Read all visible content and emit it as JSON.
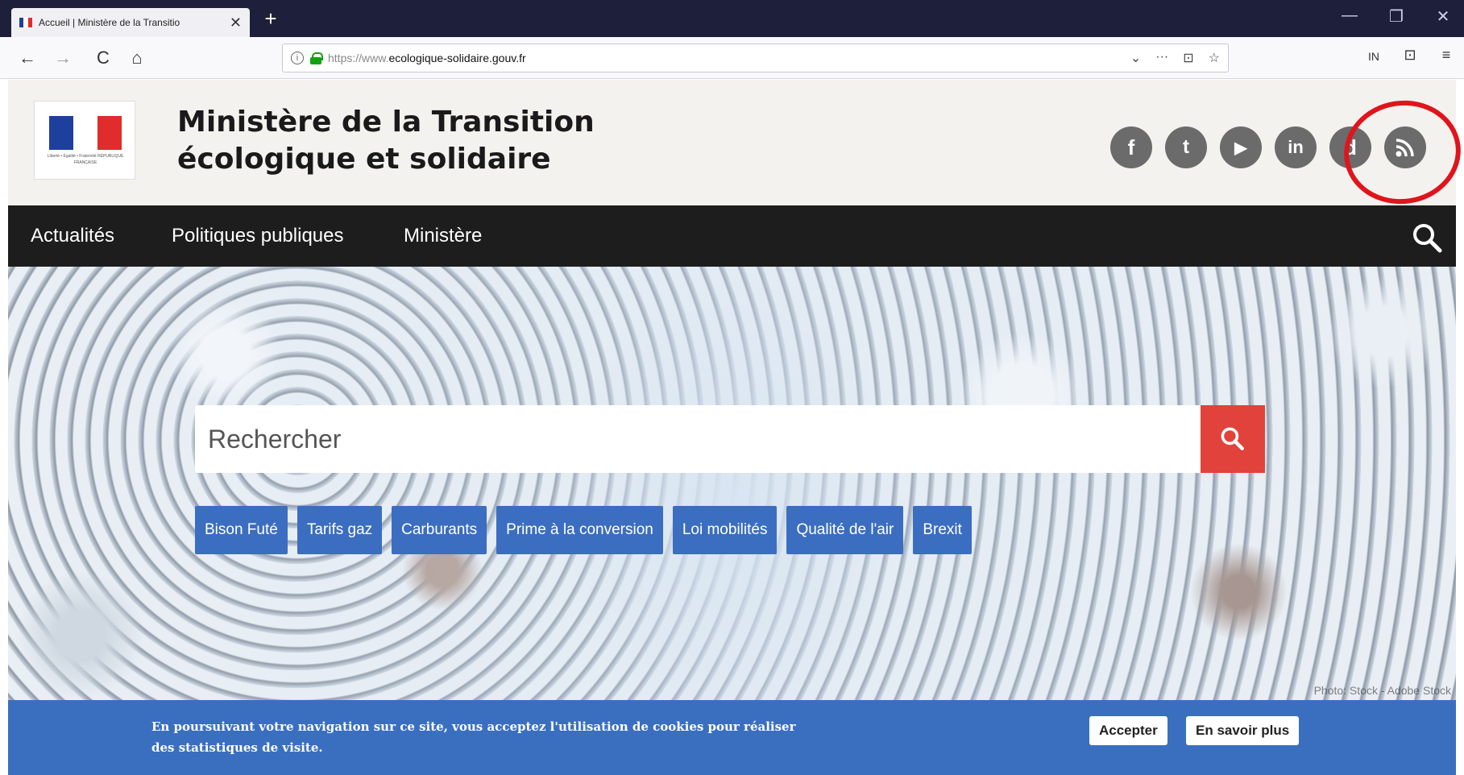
{
  "browser": {
    "tab_title": "Accueil | Ministère de la Transitio",
    "tab_close": "✕",
    "new_tab": "+",
    "window_controls": [
      "—",
      "❐",
      "✕"
    ],
    "nav": {
      "back": "←",
      "forward": "→",
      "reload": "C",
      "home": "⌂"
    },
    "url_prefix": "https://www.",
    "url_domain": "ecologique-solidaire.gouv.fr",
    "url_icons": [
      "⌄",
      "···",
      "⊡",
      "☆"
    ],
    "right_icons": [
      "IN",
      "⊡",
      "≡"
    ]
  },
  "header": {
    "title_line1": "Ministère de la Transition",
    "title_line2": "écologique et solidaire",
    "motto": "Liberté • Égalité • Fraternité RÉPUBLIQUE FRANÇAISE",
    "social": [
      {
        "name": "facebook",
        "glyph": "f"
      },
      {
        "name": "twitter",
        "glyph": "t"
      },
      {
        "name": "youtube",
        "glyph": "▶"
      },
      {
        "name": "linkedin",
        "glyph": "in"
      },
      {
        "name": "dailymotion",
        "glyph": "d"
      },
      {
        "name": "rss",
        "glyph": ""
      }
    ]
  },
  "nav": {
    "items": [
      "Actualités",
      "Politiques publiques",
      "Ministère"
    ]
  },
  "search": {
    "placeholder": "Rechercher"
  },
  "tags": [
    "Bison Futé",
    "Tarifs gaz",
    "Carburants",
    "Prime à la conversion",
    "Loi mobilités",
    "Qualité de l'air",
    "Brexit"
  ],
  "hero": {
    "credit": "Photo: Stock - Adobe Stock"
  },
  "cookie": {
    "line1": "En poursuivant votre navigation sur ce site, vous acceptez l'utilisation de cookies pour réaliser",
    "line2": "des statistiques de visite.",
    "accept": "Accepter",
    "more": "En savoir plus"
  },
  "colors": {
    "nav_bg": "#1d1d1d",
    "search_button": "#e1423b",
    "tag_bg": "#3b6ec0",
    "cookie_bg": "#3a6fc0",
    "highlight": "#e0141c"
  }
}
